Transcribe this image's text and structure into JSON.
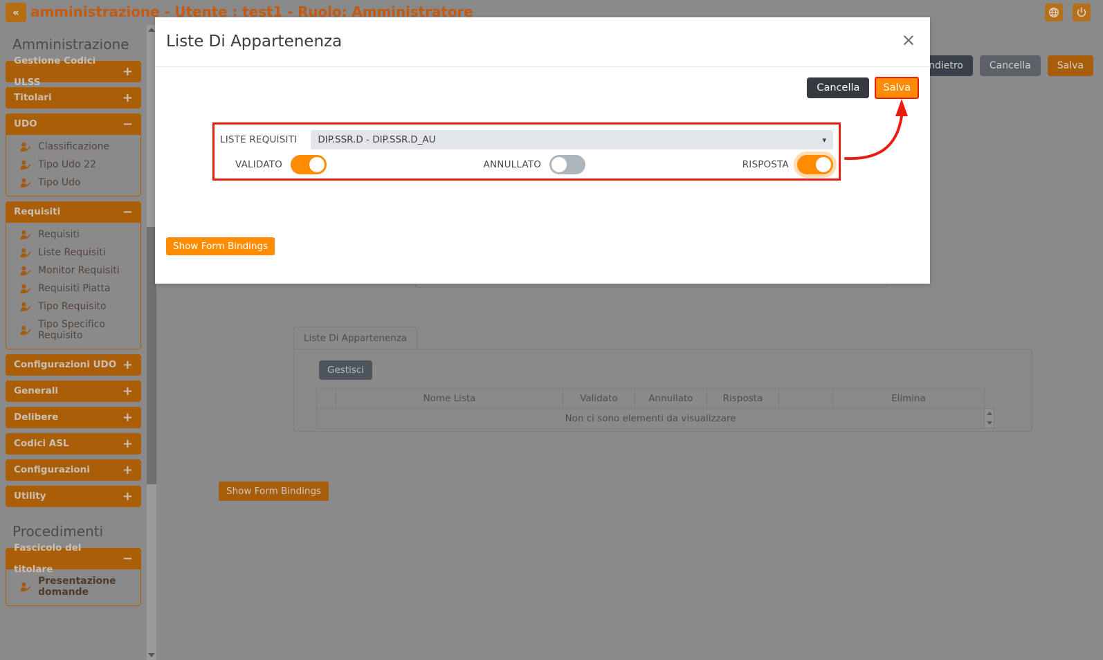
{
  "topbar": {
    "collapse_label": "«",
    "title": "amministrazione - Utente : test1 - Ruolo: Amministratore",
    "globe_icon": "globe-icon",
    "power_icon": "power-icon"
  },
  "sidebar": {
    "section_title": "Amministrazione",
    "section_title_2": "Procedimenti",
    "groups": [
      {
        "label": "Gestione Codici ULSS",
        "sign": "+",
        "open": false,
        "items": []
      },
      {
        "label": "Titolari",
        "sign": "+",
        "open": false,
        "items": []
      },
      {
        "label": "UDO",
        "sign": "−",
        "open": true,
        "items": [
          "Classificazione",
          "Tipo Udo 22",
          "Tipo Udo"
        ]
      },
      {
        "label": "Requisiti",
        "sign": "−",
        "open": true,
        "items": [
          "Requisiti",
          "Liste Requisiti",
          "Monitor Requisiti",
          "Requisiti Piatta",
          "Tipo Requisito",
          "Tipo Specifico Requisito"
        ]
      },
      {
        "label": "Configurazioni UDO",
        "sign": "+",
        "open": false,
        "items": []
      },
      {
        "label": "Generali",
        "sign": "+",
        "open": false,
        "items": []
      },
      {
        "label": "Delibere",
        "sign": "+",
        "open": false,
        "items": []
      },
      {
        "label": "Codici ASL",
        "sign": "+",
        "open": false,
        "items": []
      },
      {
        "label": "Configurazioni",
        "sign": "+",
        "open": false,
        "items": []
      },
      {
        "label": "Utility",
        "sign": "+",
        "open": false,
        "items": []
      }
    ],
    "groups2": [
      {
        "label": "Fascicolo del titolare",
        "sign": "−",
        "open": true,
        "items": [
          "Presentazione domande"
        ]
      }
    ]
  },
  "page": {
    "actions": [
      {
        "label": "Indietro",
        "style": "dark"
      },
      {
        "label": "Cancella",
        "style": "gray"
      },
      {
        "label": "Salva",
        "style": "orange"
      }
    ],
    "tab_label": "Liste Di Appartenenza",
    "gestisci_label": "Gestisci",
    "table": {
      "headers": [
        "",
        "Nome Lista",
        "Validato",
        "Annullato",
        "Risposta",
        "",
        "Elimina"
      ],
      "empty_message": "Non ci sono elementi da visualizzare"
    },
    "bindings_label": "Show Form Bindings"
  },
  "modal": {
    "title": "Liste Di Appartenenza",
    "close_label": "×",
    "cancel_label": "Cancella",
    "save_label": "Salva",
    "bindings_label": "Show Form Bindings",
    "form": {
      "select_label": "LISTE REQUISITI",
      "select_value": "DIP.SSR.D - DIP.SSR.D_AU",
      "select_caret": "▾",
      "toggles": [
        {
          "label": "VALIDATO",
          "state": "on",
          "focused": false
        },
        {
          "label": "ANNULLATO",
          "state": "off",
          "focused": false
        },
        {
          "label": "RISPOSTA",
          "state": "on",
          "focused": true
        }
      ]
    }
  },
  "colors": {
    "accent_orange": "#ff8c00",
    "brand_brown": "#ab5e08",
    "annotation_red": "#e81d0f",
    "backdrop_gray": "#8a8a8a",
    "dark_button": "#343a40"
  }
}
